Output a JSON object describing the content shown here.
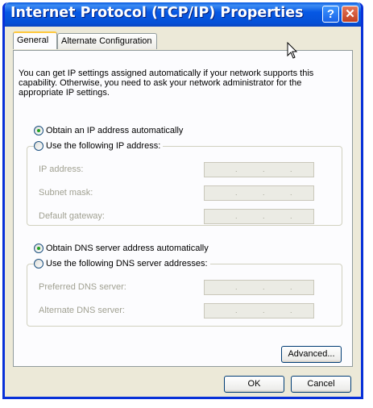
{
  "window": {
    "title": "Internet Protocol (TCP/IP) Properties",
    "help_glyph": "?",
    "close_glyph": "✕"
  },
  "tabs": [
    {
      "label": "General",
      "active": true
    },
    {
      "label": "Alternate Configuration",
      "active": false
    }
  ],
  "description": "You can get IP settings assigned automatically if your network supports this capability. Otherwise, you need to ask your network administrator for the appropriate IP settings.",
  "ip_section": {
    "auto_label": "Obtain an IP address automatically",
    "manual_label": "Use the following IP address:",
    "selected": "auto",
    "fields": [
      {
        "label": "IP address:",
        "value": ""
      },
      {
        "label": "Subnet mask:",
        "value": ""
      },
      {
        "label": "Default gateway:",
        "value": ""
      }
    ]
  },
  "dns_section": {
    "auto_label": "Obtain DNS server address automatically",
    "manual_label": "Use the following DNS server addresses:",
    "selected": "auto",
    "fields": [
      {
        "label": "Preferred DNS server:",
        "value": ""
      },
      {
        "label": "Alternate DNS server:",
        "value": ""
      }
    ]
  },
  "buttons": {
    "advanced": "Advanced...",
    "ok": "OK",
    "cancel": "Cancel"
  },
  "colors": {
    "titlebar": "#0550d6",
    "dialog_bg": "#ece9d8",
    "radio_selected": "#21a121"
  }
}
